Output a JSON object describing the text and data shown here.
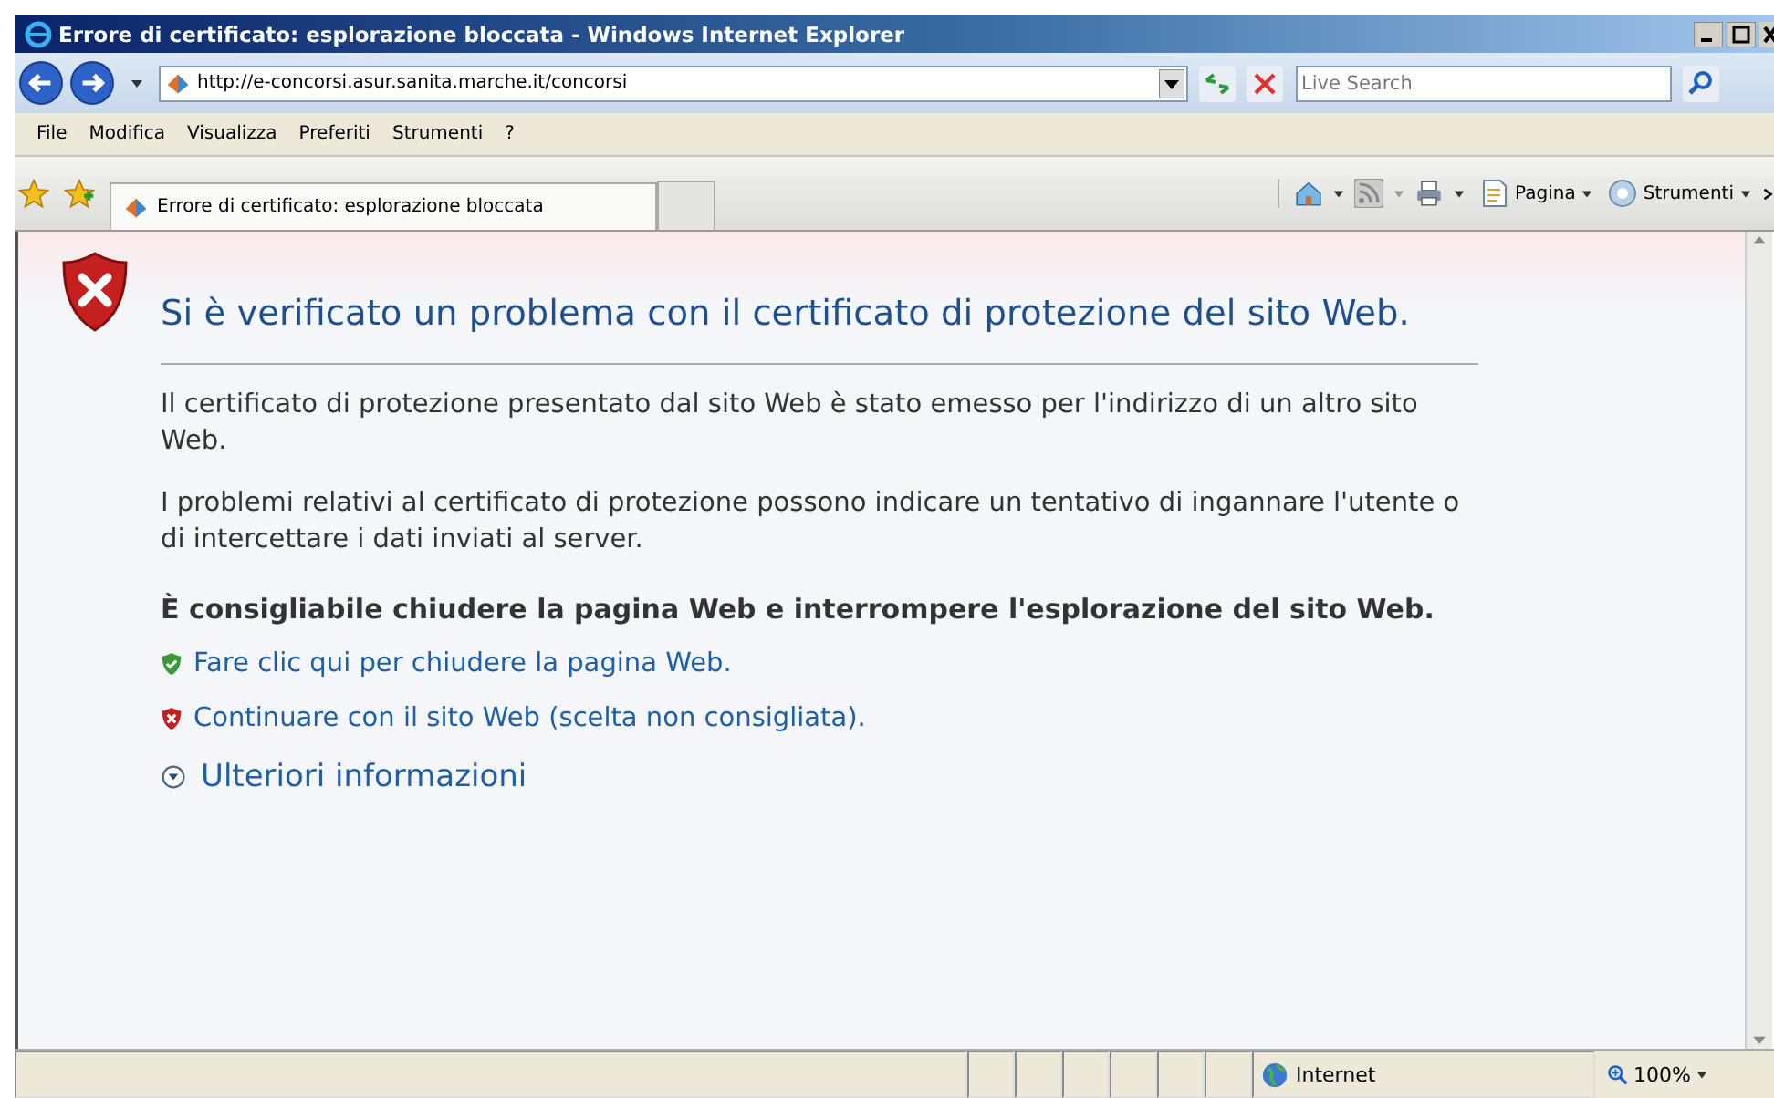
{
  "window": {
    "title": "Errore di certificato: esplorazione bloccata - Windows Internet Explorer"
  },
  "address_bar": {
    "url": "http://e-concorsi.asur.sanita.marche.it/concorsi"
  },
  "search": {
    "placeholder": "Live Search"
  },
  "menu": [
    "File",
    "Modifica",
    "Visualizza",
    "Preferiti",
    "Strumenti",
    "?"
  ],
  "tabs": [
    {
      "label": "Errore di certificato: esplorazione bloccata",
      "selected": true
    }
  ],
  "command_bar": [
    {
      "kind": "home"
    },
    {
      "kind": "feed"
    },
    {
      "kind": "print"
    },
    {
      "kind": "page",
      "label": "Pagina"
    },
    {
      "kind": "tools",
      "label": "Strumenti"
    }
  ],
  "content": {
    "heading": "Si è verificato un problema con il certificato di protezione del sito Web.",
    "paragraphs": [
      "Il certificato di protezione presentato dal sito Web è stato emesso per l'indirizzo di un altro sito Web.",
      "I problemi relativi al certificato di protezione possono indicare un tentativo di ingannare l'utente o di intercettare i dati inviati al server."
    ],
    "recommendation": "È consigliabile chiudere la pagina Web e interrompere l'esplorazione del sito Web.",
    "links": [
      {
        "kind": "safe",
        "label": "Fare clic qui per chiudere la pagina Web."
      },
      {
        "kind": "unsafe",
        "label": "Continuare con il sito Web (scelta non consigliata)."
      }
    ],
    "more_info": {
      "label": "Ulteriori informazioni",
      "expanded": false
    }
  },
  "status_bar": {
    "zone": "Internet",
    "zoom": "100%"
  }
}
